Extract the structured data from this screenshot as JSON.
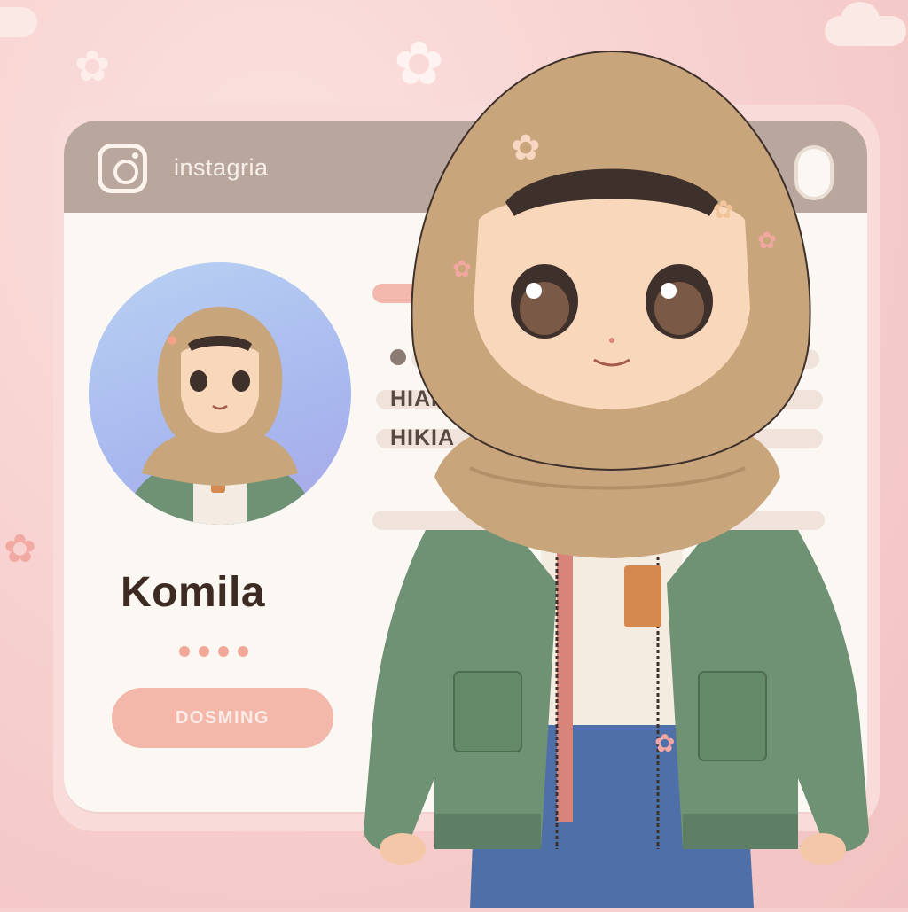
{
  "app": {
    "name": "instagria"
  },
  "profile": {
    "name": "Komila",
    "action_label": "DOSMING"
  },
  "stats": {
    "line1": "HIAI",
    "line2": "HIKIA"
  },
  "colors": {
    "background": "#f7cfcf",
    "header": "#b9a79d",
    "card": "#fbf8f4",
    "accent": "#f4b8ab",
    "jacket": "#6f9174",
    "hijab": "#c9a57c"
  },
  "icons": [
    "camera-logo-icon",
    "blossom-icon"
  ]
}
